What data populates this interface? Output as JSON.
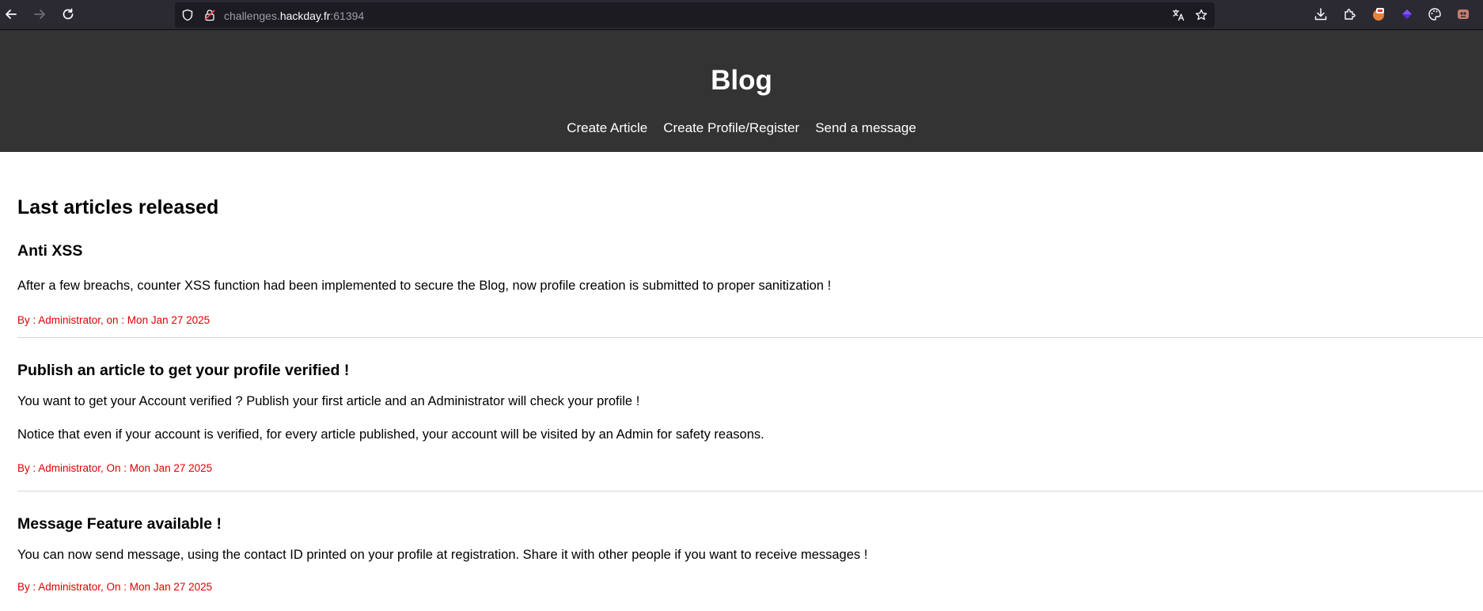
{
  "browser": {
    "url_prefix": "challenges.",
    "url_host": "hackday.fr",
    "url_port": ":61394"
  },
  "site": {
    "title": "Blog",
    "nav": [
      "Create Article",
      "Create Profile/Register",
      "Send a message"
    ]
  },
  "main": {
    "section_title": "Last articles released",
    "articles": [
      {
        "title": "Anti XSS",
        "paragraphs": [
          "After a few breachs, counter XSS function had been implemented to secure the Blog, now profile creation is submitted to proper sanitization !"
        ],
        "meta": "By : Administrator, on : Mon Jan 27 2025"
      },
      {
        "title": "Publish an article to get your profile verified !",
        "paragraphs": [
          "You want to get your Account verified ? Publish your first article and an Administrator will check your profile !",
          "Notice that even if your account is verified, for every article published, your account will be visited by an Admin for safety reasons."
        ],
        "meta": "By : Administrator, On : Mon Jan 27 2025"
      },
      {
        "title": "Message Feature available !",
        "paragraphs": [
          "You can now send message, using the contact ID printed on your profile at registration. Share it with other people if you want to receive messages !"
        ],
        "meta": "By : Administrator, On : Mon Jan 27 2025"
      }
    ]
  }
}
